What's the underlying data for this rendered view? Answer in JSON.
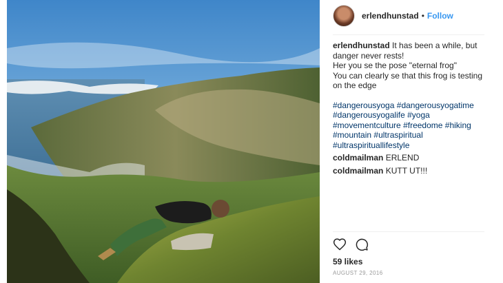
{
  "header": {
    "username": "erlendhunstad",
    "separator": "•",
    "follow_label": "Follow"
  },
  "caption": {
    "username": "erlendhunstad",
    "lines": [
      "It has been a while, but danger never rests!",
      "Her you se the pose \"eternal frog\"",
      "You can clearly se that this frog is testing on the edge"
    ],
    "hashtags": [
      "#dangerousyoga",
      "#dangerousyogatime",
      "#dangerousyogalife",
      "#yoga",
      "#movementculture",
      "#freedome",
      "#hiking",
      "#mountain",
      "#ultraspiritual",
      "#ultraspirituallifestyle"
    ]
  },
  "comments": [
    {
      "username": "coldmailman",
      "text": "ERLEND"
    },
    {
      "username": "coldmailman",
      "text": "KUTT UT!!!"
    }
  ],
  "actions": {
    "like_icon": "heart-icon",
    "comment_icon": "comment-icon"
  },
  "likes": "59 likes",
  "date": "AUGUST 29, 2016",
  "colors": {
    "link": "#003569",
    "follow": "#3897f0",
    "text": "#262626",
    "muted": "#999999"
  }
}
